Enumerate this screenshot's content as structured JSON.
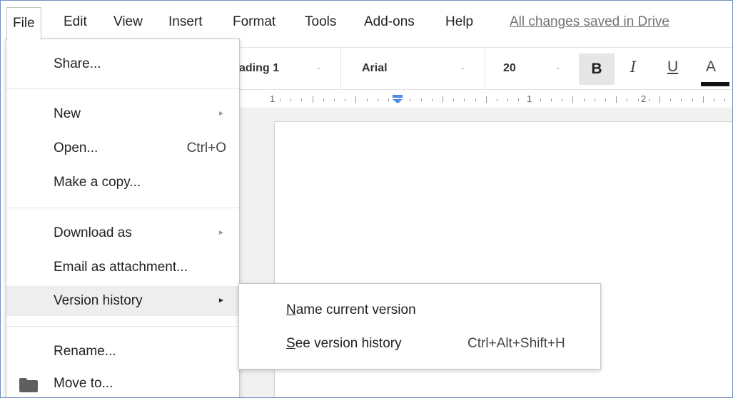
{
  "menubar": {
    "items": [
      {
        "label": "File"
      },
      {
        "label": "Edit"
      },
      {
        "label": "View"
      },
      {
        "label": "Insert"
      },
      {
        "label": "Format"
      },
      {
        "label": "Tools"
      },
      {
        "label": "Add-ons"
      },
      {
        "label": "Help"
      }
    ],
    "save_status": "All changes saved in Drive"
  },
  "toolbar": {
    "style": "ading 1",
    "font": "Arial",
    "size": "20",
    "bold": "B",
    "italic": "I",
    "underline": "U",
    "text_color": "A",
    "dropdown_glyph": "-"
  },
  "ruler": {
    "numbers": [
      "1",
      "1",
      "2"
    ]
  },
  "file_menu": {
    "share": "Share...",
    "new": "New",
    "open": "Open...",
    "open_shortcut": "Ctrl+O",
    "make_copy": "Make a copy...",
    "download_as": "Download as",
    "email_attachment": "Email as attachment...",
    "version_history": "Version history",
    "rename": "Rename...",
    "move_to": "Move to...",
    "arrow_glyph": "►"
  },
  "version_submenu": {
    "name_current_first": "N",
    "name_current_rest": "ame current version",
    "see_history_first": "S",
    "see_history_rest": "ee version history",
    "see_history_shortcut": "Ctrl+Alt+Shift+H"
  }
}
